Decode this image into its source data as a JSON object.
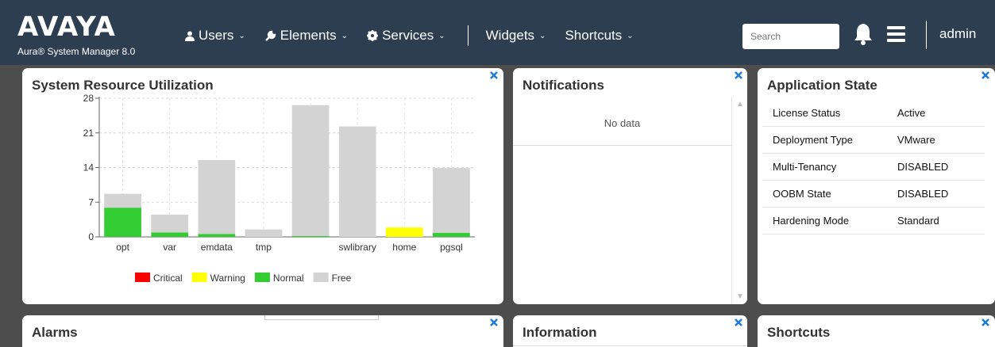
{
  "header": {
    "logo": "AVAYA",
    "subtitle": "Aura® System Manager 8.0",
    "nav": [
      {
        "label": "Users",
        "icon": "user-icon"
      },
      {
        "label": "Elements",
        "icon": "wrench-icon"
      },
      {
        "label": "Services",
        "icon": "gear-icon"
      },
      {
        "label": "Widgets",
        "icon": ""
      },
      {
        "label": "Shortcuts",
        "icon": ""
      }
    ],
    "search_placeholder": "Search",
    "user": "admin"
  },
  "panels": {
    "system_resource": {
      "title": "System Resource Utilization"
    },
    "notifications": {
      "title": "Notifications",
      "empty_text": "No data"
    },
    "application_state": {
      "title": "Application State",
      "rows": [
        {
          "key": "License Status",
          "value": "Active"
        },
        {
          "key": "Deployment Type",
          "value": "VMware"
        },
        {
          "key": "Multi-Tenancy",
          "value": "DISABLED"
        },
        {
          "key": "OOBM State",
          "value": "DISABLED"
        },
        {
          "key": "Hardening Mode",
          "value": "Standard"
        }
      ]
    },
    "alarms": {
      "title": "Alarms"
    },
    "information": {
      "title": "Information"
    },
    "shortcuts": {
      "title": "Shortcuts"
    }
  },
  "colors": {
    "header_bg": "#2c3e50",
    "critical": "#ff0000",
    "warning": "#ffff00",
    "normal": "#33cc33",
    "free": "#d3d3d3",
    "close": "#1f7bd6"
  },
  "chart_data": {
    "type": "bar",
    "stacked": true,
    "categories": [
      "opt",
      "var",
      "emdata",
      "tmp",
      "",
      "swlibrary",
      "home",
      "pgsql"
    ],
    "ylim": [
      0,
      28
    ],
    "yticks": [
      0,
      7,
      14,
      21,
      28
    ],
    "grid": true,
    "legend_position": "bottom",
    "series": [
      {
        "name": "Critical",
        "color": "#ff0000",
        "values": [
          0,
          0,
          0,
          0,
          0,
          0,
          0,
          0
        ]
      },
      {
        "name": "Warning",
        "color": "#ffff00",
        "values": [
          0,
          0,
          0,
          0,
          0,
          0,
          1.9,
          0
        ]
      },
      {
        "name": "Normal",
        "color": "#33cc33",
        "values": [
          5.9,
          0.9,
          0.6,
          0,
          0.2,
          0,
          0,
          0.8
        ]
      },
      {
        "name": "Free",
        "color": "#d3d3d3",
        "values": [
          2.8,
          3.6,
          14.9,
          1.5,
          26.4,
          22.3,
          0,
          13.1
        ]
      }
    ]
  }
}
